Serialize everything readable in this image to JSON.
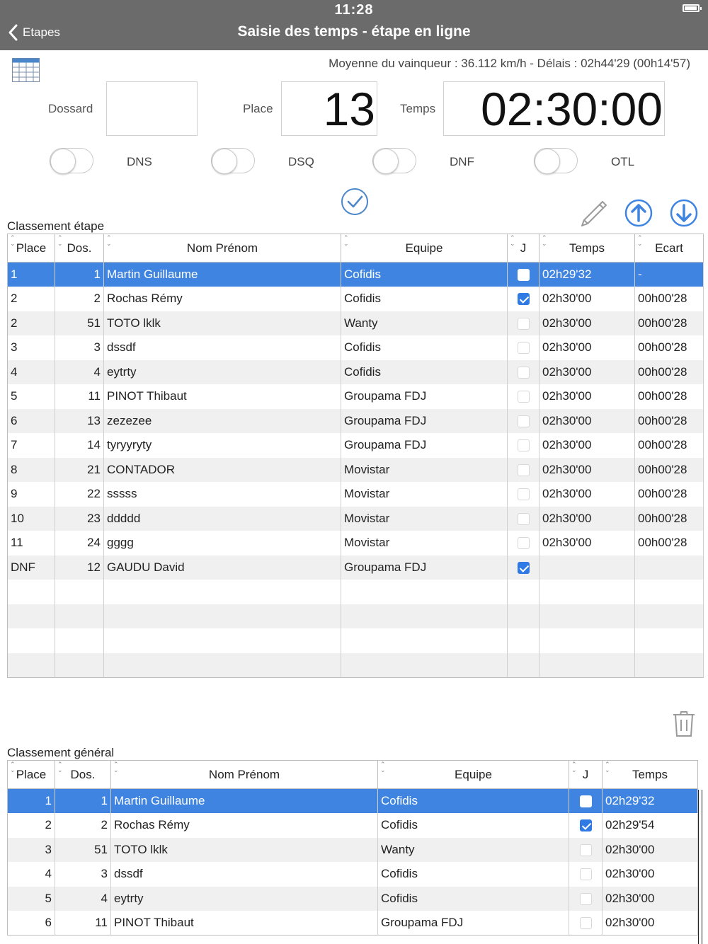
{
  "status": {
    "time": "11:28"
  },
  "nav": {
    "back_label": "Etapes",
    "title": "Saisie des temps - étape en ligne"
  },
  "info": {
    "winner_text": "Moyenne du vainqueur : 36.112 km/h - Délais : 02h44'29 (00h14'57)"
  },
  "form": {
    "dossard_label": "Dossard",
    "dossard_value": "",
    "place_label": "Place",
    "place_value": "13",
    "temps_label": "Temps",
    "temps_value": "02:30:00"
  },
  "toggles": [
    {
      "label": "DNS",
      "on": false
    },
    {
      "label": "DSQ",
      "on": false
    },
    {
      "label": "DNF",
      "on": false
    },
    {
      "label": "OTL",
      "on": false
    }
  ],
  "colors": {
    "accent": "#3f84e0",
    "topbar": "#6b6b6b"
  },
  "stage": {
    "title": "Classement étape",
    "columns": [
      "Place",
      "Dos.",
      "Nom Prénom",
      "Equipe",
      "J",
      "Temps",
      "Ecart"
    ],
    "rows": [
      {
        "place": "1",
        "dos": "1",
        "name": "Martin Guillaume",
        "team": "Cofidis",
        "j": false,
        "time": "02h29'32",
        "gap": "-"
      },
      {
        "place": "2",
        "dos": "2",
        "name": "Rochas Rémy",
        "team": "Cofidis",
        "j": true,
        "time": "02h30'00",
        "gap": "00h00'28"
      },
      {
        "place": "2",
        "dos": "51",
        "name": "TOTO lklk",
        "team": "Wanty",
        "j": false,
        "time": "02h30'00",
        "gap": "00h00'28"
      },
      {
        "place": "3",
        "dos": "3",
        "name": "dssdf",
        "team": "Cofidis",
        "j": false,
        "time": "02h30'00",
        "gap": "00h00'28"
      },
      {
        "place": "4",
        "dos": "4",
        "name": "eytrty",
        "team": "Cofidis",
        "j": false,
        "time": "02h30'00",
        "gap": "00h00'28"
      },
      {
        "place": "5",
        "dos": "11",
        "name": "PINOT Thibaut",
        "team": "Groupama FDJ",
        "j": false,
        "time": "02h30'00",
        "gap": "00h00'28"
      },
      {
        "place": "6",
        "dos": "13",
        "name": "zezezee",
        "team": "Groupama FDJ",
        "j": false,
        "time": "02h30'00",
        "gap": "00h00'28"
      },
      {
        "place": "7",
        "dos": "14",
        "name": "tyryyryty",
        "team": "Groupama FDJ",
        "j": false,
        "time": "02h30'00",
        "gap": "00h00'28"
      },
      {
        "place": "8",
        "dos": "21",
        "name": "CONTADOR",
        "team": "Movistar",
        "j": false,
        "time": "02h30'00",
        "gap": "00h00'28"
      },
      {
        "place": "9",
        "dos": "22",
        "name": "sssss",
        "team": "Movistar",
        "j": false,
        "time": "02h30'00",
        "gap": "00h00'28"
      },
      {
        "place": "10",
        "dos": "23",
        "name": "ddddd",
        "team": "Movistar",
        "j": false,
        "time": "02h30'00",
        "gap": "00h00'28"
      },
      {
        "place": "11",
        "dos": "24",
        "name": "gggg",
        "team": "Movistar",
        "j": false,
        "time": "02h30'00",
        "gap": "00h00'28"
      },
      {
        "place": "DNF",
        "dos": "12",
        "name": "GAUDU David",
        "team": "Groupama FDJ",
        "j": true,
        "time": "",
        "gap": ""
      }
    ]
  },
  "general": {
    "title": "Classement général",
    "columns": [
      "Place",
      "Dos.",
      "Nom Prénom",
      "Equipe",
      "J",
      "Temps"
    ],
    "rows": [
      {
        "place": "1",
        "dos": "1",
        "name": "Martin Guillaume",
        "team": "Cofidis",
        "j": false,
        "time": "02h29'32"
      },
      {
        "place": "2",
        "dos": "2",
        "name": "Rochas Rémy",
        "team": "Cofidis",
        "j": true,
        "time": "02h29'54"
      },
      {
        "place": "3",
        "dos": "51",
        "name": "TOTO lklk",
        "team": "Wanty",
        "j": false,
        "time": "02h30'00"
      },
      {
        "place": "4",
        "dos": "3",
        "name": "dssdf",
        "team": "Cofidis",
        "j": false,
        "time": "02h30'00"
      },
      {
        "place": "5",
        "dos": "4",
        "name": "eytrty",
        "team": "Cofidis",
        "j": false,
        "time": "02h30'00"
      },
      {
        "place": "6",
        "dos": "11",
        "name": "PINOT Thibaut",
        "team": "Groupama FDJ",
        "j": false,
        "time": "02h30'00"
      }
    ]
  }
}
